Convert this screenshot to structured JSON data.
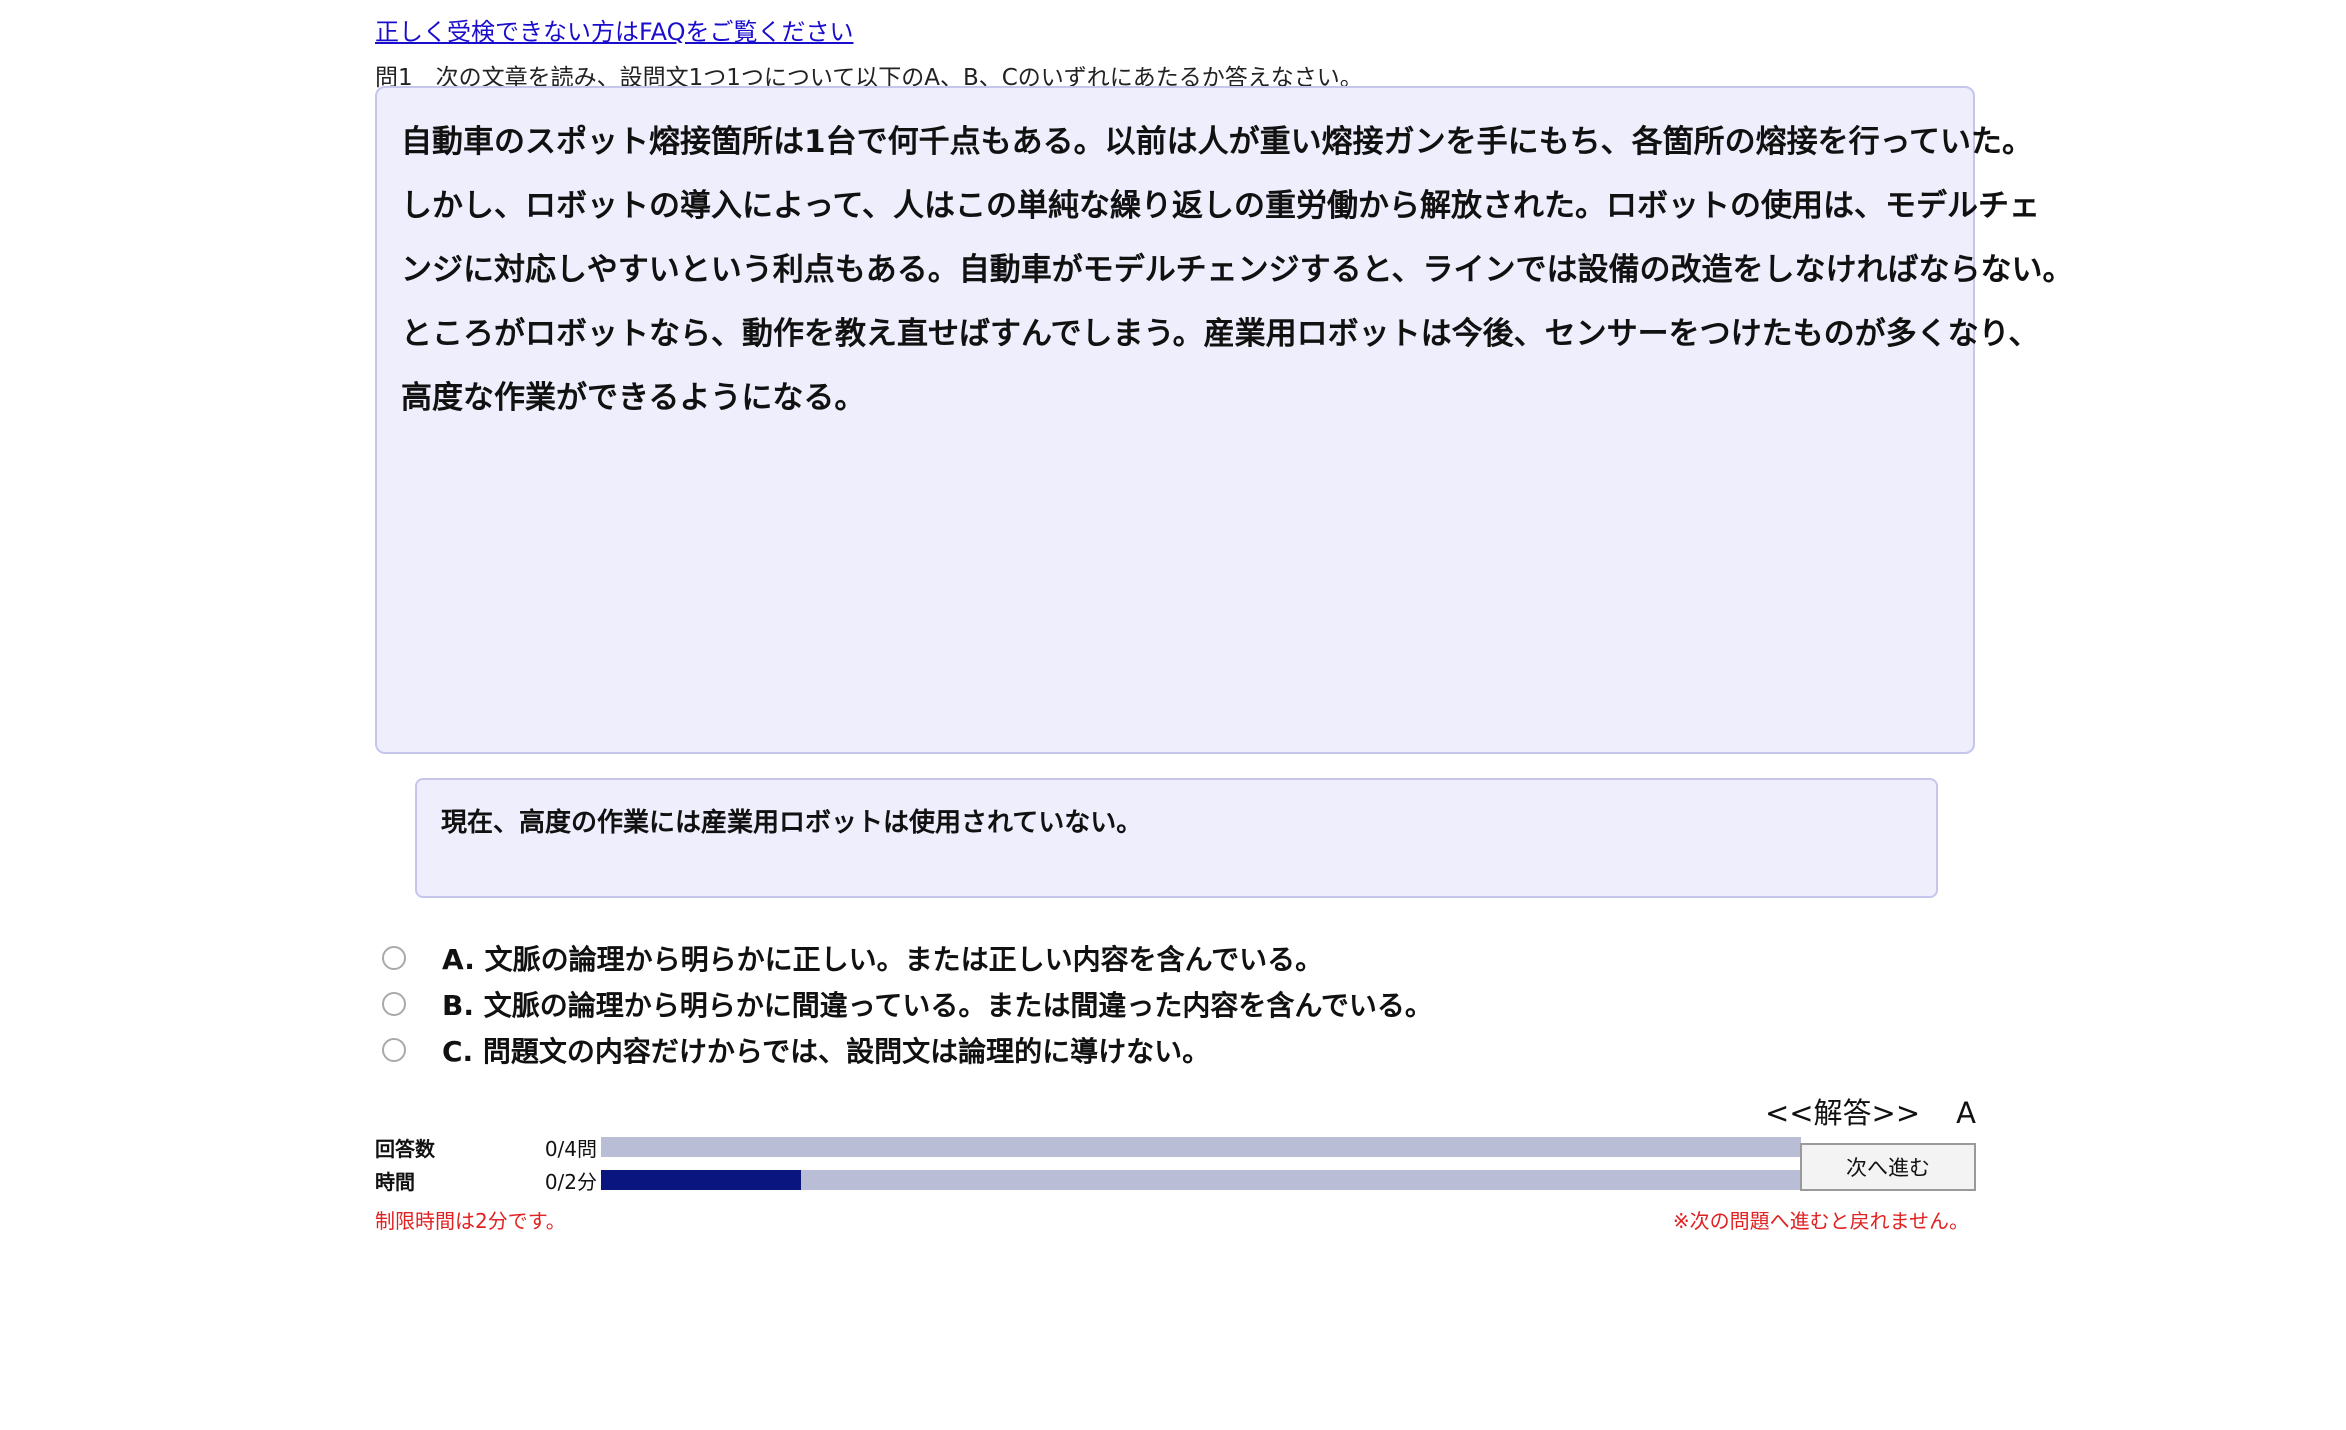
{
  "header": {
    "faq_link": "正しく受検できない方はFAQをご覧ください",
    "instruction": "問1　次の文章を読み、設問文1つ1つについて以下のA、B、Cのいずれにあたるか答えなさい。"
  },
  "passage": {
    "lines": [
      " 自動車のスポット熔接箇所は1台で何千点もある。以前は人が重い熔接ガンを手にもち、各箇所の熔接を行っていた。",
      "しかし、ロボットの導入によって、人はこの単純な繰り返しの重労働から解放された。ロボットの使用は、モデルチェ",
      "ンジに対応しやすいという利点もある。自動車がモデルチェンジすると、ラインでは設備の改造をしなければならない。",
      "ところがロボットなら、動作を教え直せばすんでしまう。産業用ロボットは今後、センサーをつけたものが多くなり、",
      "高度な作業ができるようになる。"
    ]
  },
  "statement": "現在、高度の作業には産業用ロボットは使用されていない。",
  "options": [
    {
      "label": "A. 文脈の論理から明らかに正しい。または正しい内容を含んでいる。"
    },
    {
      "label": "B. 文脈の論理から明らかに間違っている。または間違った内容を含んでいる。"
    },
    {
      "label": "C. 問題文の内容だけからでは、設問文は論理的に導けない。"
    }
  ],
  "answer": {
    "label": "<<解答>>",
    "value": "A"
  },
  "progress": {
    "answered_label": "回答数",
    "answered_value": "0/4問",
    "answered_fraction": 0,
    "time_label": "時間",
    "time_value": "0/2分",
    "time_fraction": 0.167
  },
  "next_button": "次へ進む",
  "notes": {
    "time_limit": "制限時間は2分です。",
    "no_return": "※次の問題へ進むと戻れません。"
  },
  "colors": {
    "link": "#1a0dcc",
    "panel_bg": "#eeeefc",
    "panel_border": "#c6c6ec",
    "bar_track": "#b9bdd6",
    "bar_fill": "#0a1580",
    "warning": "#e02222"
  }
}
